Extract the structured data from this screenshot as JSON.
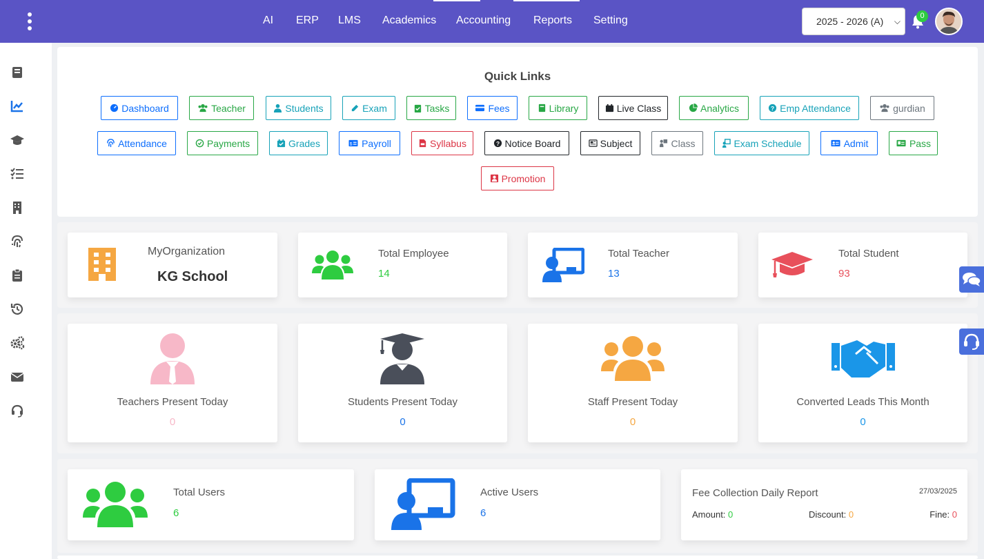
{
  "nav": {
    "items": [
      "AI",
      "ERP",
      "LMS",
      "Academics",
      "Accounting",
      "Reports",
      "Setting"
    ],
    "session": "2025 - 2026 (A)",
    "notification_count": "0"
  },
  "sidebar": {
    "items": [
      "book-icon",
      "chart-line-icon",
      "graduation-cap-icon",
      "list-check-icon",
      "building-icon",
      "fingerprint-icon",
      "clipboard-icon",
      "history-icon",
      "gears-icon",
      "envelope-icon",
      "headset-icon"
    ]
  },
  "quick_links": {
    "title": "Quick Links",
    "items": [
      "Dashboard",
      "Teacher",
      "Students",
      "Exam",
      "Tasks",
      "Fees",
      "Library",
      "Live Class",
      "Analytics",
      "Emp Attendance",
      "gurdian",
      "Attendance",
      "Payments",
      "Grades",
      "Payroll",
      "Syllabus",
      "Notice Board",
      "Subject",
      "Class",
      "Exam Schedule",
      "Admit",
      "Pass",
      "Promotion"
    ]
  },
  "stats": {
    "org_label": "MyOrganization",
    "org_name": "KG School",
    "employee_label": "Total Employee",
    "employee_value": "14",
    "teacher_label": "Total Teacher",
    "teacher_value": "13",
    "student_label": "Total Student",
    "student_value": "93"
  },
  "presence": {
    "teachers_label": "Teachers Present Today",
    "teachers_value": "0",
    "students_label": "Students Present Today",
    "students_value": "0",
    "staff_label": "Staff Present Today",
    "staff_value": "0",
    "leads_label": "Converted Leads This Month",
    "leads_value": "0"
  },
  "users": {
    "total_label": "Total Users",
    "total_value": "6",
    "active_label": "Active Users",
    "active_value": "6"
  },
  "fee_report": {
    "title": "Fee Collection Daily Report",
    "date": "27/03/2025",
    "amount_label": "Amount:",
    "amount_value": "0",
    "discount_label": "Discount:",
    "discount_value": "0",
    "fine_label": "Fine:",
    "fine_value": "0"
  },
  "colors": {
    "topbar": "#5a54c5",
    "green": "#2ecc40",
    "blue": "#1a73e8",
    "red": "#e8505b",
    "orange": "#f5a742",
    "pink": "#f7b8c8",
    "dark": "#4a4f5a"
  }
}
